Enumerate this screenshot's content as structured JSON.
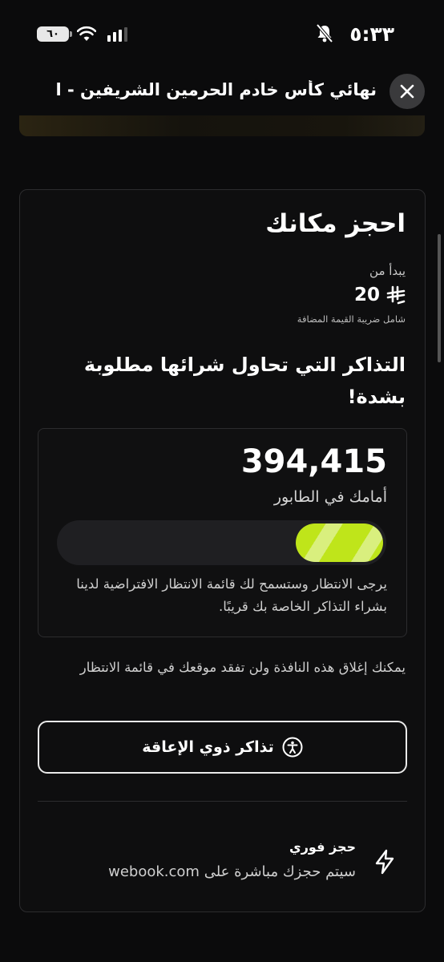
{
  "status_bar": {
    "time": "٥:٣٣",
    "battery": "٦٠"
  },
  "header": {
    "title": "نهائي كأس خادم الحرمين الشريفين - ال..."
  },
  "booking": {
    "title": "احجز مكانك",
    "starts_from": "يبدأ من",
    "price": "20",
    "vat_note": "شامل ضريبة القيمة المضافة",
    "demand_text": "التذاكر التي تحاول شرائها مطلوبة بشدة!"
  },
  "queue": {
    "position": "394,415",
    "label": "أمامك في الطابور",
    "progress_fraction": 0.27,
    "note": "يرجى الانتظار وستسمح لك قائمة الانتظار الافتراضية لدينا بشراء التذاكر الخاصة بك قريبًا."
  },
  "close_note": "يمكنك إغلاق هذه النافذة ولن تفقد موقعك في قائمة الانتظار",
  "accessibility_button": {
    "label": "تذاكر ذوي الإعاقة",
    "icon": "accessibility-icon"
  },
  "instant_booking": {
    "title": "حجز فوري",
    "subtitle": "سيتم حجزك مباشرة على webook.com",
    "icon": "lightning-icon"
  },
  "colors": {
    "accent": "#bfe51a",
    "background": "#0b0b0c"
  }
}
